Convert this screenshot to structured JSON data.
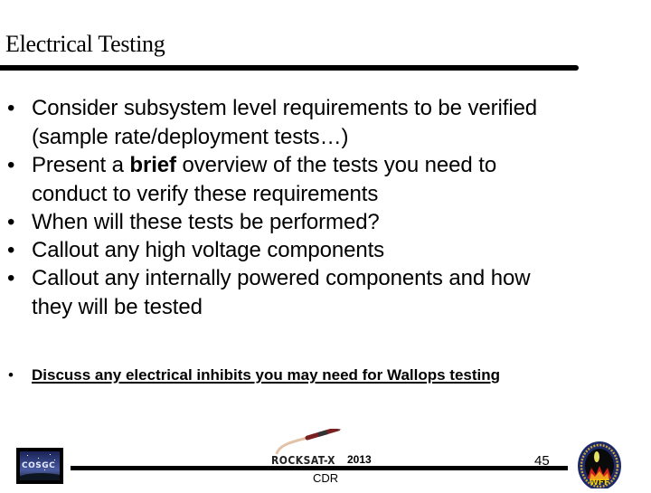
{
  "slide": {
    "title": "Electrical Testing",
    "bullets": [
      {
        "pre": "Consider subsystem level requirements to be verified",
        "line2": "(sample rate/deployment tests…)"
      },
      {
        "pre": "Present a ",
        "bold": "brief",
        "post": " overview of the tests you need to",
        "line2": "conduct to verify these requirements"
      },
      {
        "pre": "When will these tests be performed?"
      },
      {
        "pre": "Callout any high voltage components"
      },
      {
        "pre": "Callout any internally powered components and how",
        "line2": "they will be tested"
      }
    ],
    "small_bullet": "Discuss any electrical inhibits you may need for Wallops testing",
    "bullet_glyph": "•"
  },
  "footer": {
    "left_logo_text": "COSGC",
    "center_logo_text": "ROCKSAT-X",
    "year": "2013",
    "label": "CDR",
    "page_number": "45",
    "right_logo_text": "WFF"
  }
}
